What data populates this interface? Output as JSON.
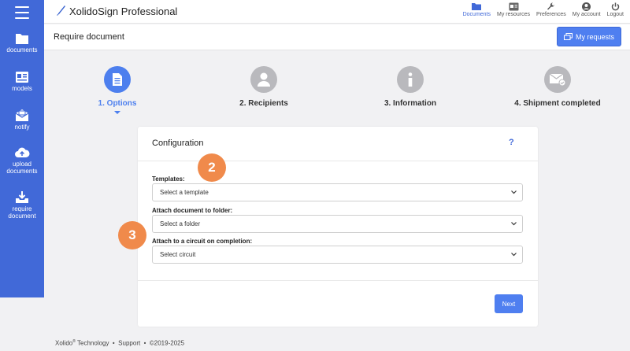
{
  "app": {
    "name": "XolidoSign Professional"
  },
  "sidebar": {
    "items": [
      {
        "label": "documents",
        "icon": "folder-icon"
      },
      {
        "label": "models",
        "icon": "id-card-icon"
      },
      {
        "label": "notify",
        "icon": "envelope-icon"
      },
      {
        "label": "upload documents",
        "icon": "cloud-upload-icon"
      },
      {
        "label": "require document",
        "icon": "tray-download-icon"
      }
    ]
  },
  "topnav": {
    "items": [
      {
        "label": "Documents",
        "icon": "folder-icon",
        "active": true
      },
      {
        "label": "My resources",
        "icon": "id-card-icon",
        "active": false
      },
      {
        "label": "Preferences",
        "icon": "wrench-icon",
        "active": false
      },
      {
        "label": "My account",
        "icon": "user-icon",
        "active": false
      },
      {
        "label": "Logout",
        "icon": "power-icon",
        "active": false
      }
    ]
  },
  "header": {
    "title": "Require document",
    "my_requests": "My requests"
  },
  "steps": [
    {
      "label": "1. Options",
      "icon": "document-icon",
      "active": true
    },
    {
      "label": "2. Recipients",
      "icon": "user-icon",
      "active": false
    },
    {
      "label": "3. Information",
      "icon": "info-icon",
      "active": false
    },
    {
      "label": "4. Shipment completed",
      "icon": "envelope-check-icon",
      "active": false
    }
  ],
  "config": {
    "title": "Configuration",
    "help": "?",
    "templates_label": "Templates:",
    "templates_value": "Select a template",
    "folder_label": "Attach document to folder:",
    "folder_value": "Select a folder",
    "circuit_label": "Attach to a circuit on completion:",
    "circuit_value": "Select circuit",
    "next": "Next"
  },
  "badges": {
    "first": "2",
    "second": "3"
  },
  "footer": {
    "company": "Xolido",
    "registered": "®",
    "rest": " Technology  •  Support  •  ©2019-2025"
  },
  "colors": {
    "primary": "#4169d8",
    "button": "#4f7ff0",
    "badge": "#f08a4b"
  }
}
